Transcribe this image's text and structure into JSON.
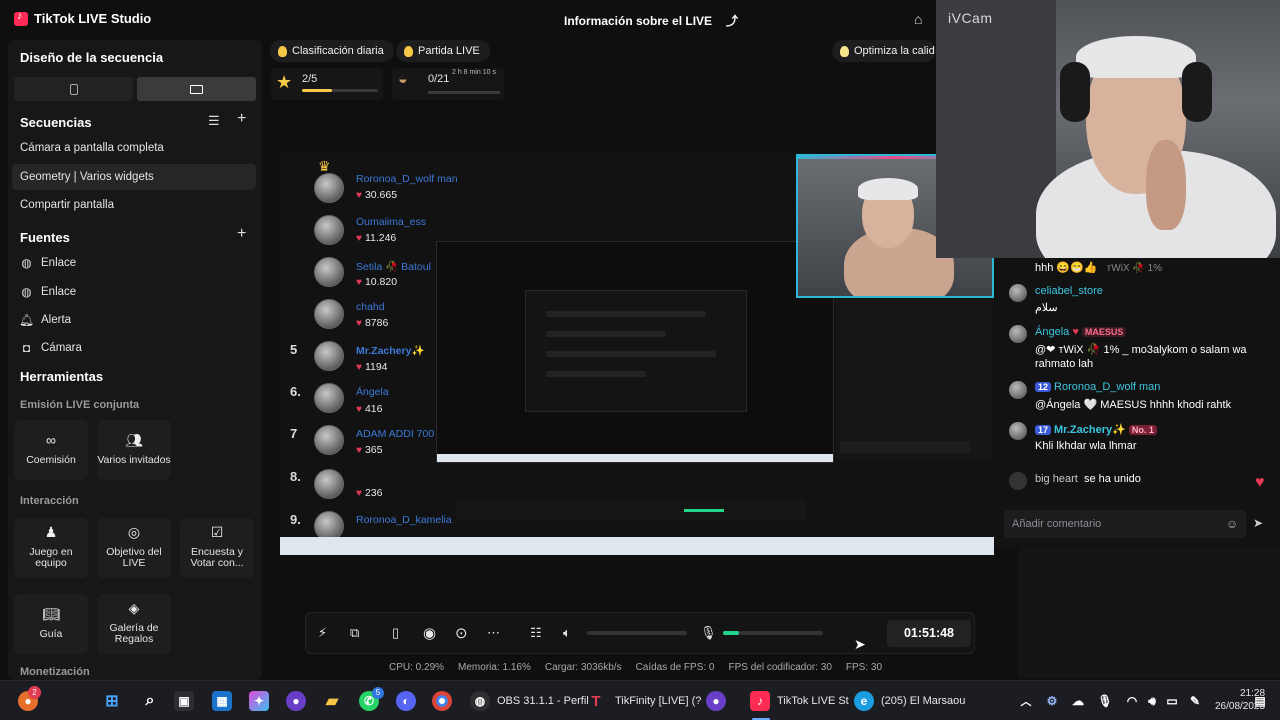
{
  "app": {
    "title": "TikTok LIVE Studio",
    "live_info": "Información sobre el LIVE"
  },
  "sidebar": {
    "design_heading": "Diseño de la secuencia",
    "sequences_heading": "Secuencias",
    "sequences": [
      "Cámara a pantalla completa",
      "Geometry | Varios widgets",
      "Compartir pantalla"
    ],
    "sources_heading": "Fuentes",
    "sources": [
      {
        "label": "Enlace",
        "icon": "globe-icon"
      },
      {
        "label": "Enlace",
        "icon": "globe-icon"
      },
      {
        "label": "Alerta",
        "icon": "bell-icon"
      },
      {
        "label": "Cámara",
        "icon": "camera-icon"
      }
    ],
    "tools_heading": "Herramientas",
    "joint_live": "Emisión LIVE conjunta",
    "tools_joint": [
      "Coemisión",
      "Varios invitados"
    ],
    "interaction": "Interacción",
    "tools_interaction": [
      "Juego en equipo",
      "Objetivo del LIVE",
      "Encuesta y Votar con..."
    ],
    "tools_more": [
      "Guía",
      "Galería de Regalos"
    ],
    "monetization": "Monetización"
  },
  "topbar": {
    "chip_daily": "Clasificación diaria",
    "chip_match": "Partida LIVE",
    "chip_optimize": "Optimiza la calid",
    "stars": "2/5",
    "stars_progress": 0.4,
    "gifts": "0/21",
    "gifts_time": "2 h 8 min 10 s",
    "gifts_progress": 0.0
  },
  "preview": {
    "leaderboard": [
      {
        "rank": "",
        "name": "Roronoa_D_wolf man",
        "score": "30.665"
      },
      {
        "rank": "",
        "name": "Oumaiima_ess",
        "score": "11.246"
      },
      {
        "rank": "",
        "name": "Setila 🥀 Batoul",
        "score": "10.820"
      },
      {
        "rank": "",
        "name": "chahd",
        "score": "8786"
      },
      {
        "rank": "5",
        "name": "Mr.Zachery✨",
        "score": "1194"
      },
      {
        "rank": "6.",
        "name": "Ángela",
        "score": "416"
      },
      {
        "rank": "7",
        "name": "ADAM ADDI 700",
        "score": "365"
      },
      {
        "rank": "8.",
        "name": "",
        "score": "236"
      },
      {
        "rank": "9.",
        "name": "Roronoa_D_kamelia",
        "score": ""
      }
    ]
  },
  "chat": {
    "messages": [
      {
        "name": "",
        "text": "hhh 😄😁👍",
        "extra": "ᴛWiX 🥀 1%"
      },
      {
        "name": "celiabel_store",
        "text": "سلام",
        "badge": ""
      },
      {
        "name": "Ángela",
        "text": "@❤ ᴛWiX 🥀 1% _ mo3alykom o salam wa rahmato lah",
        "badge": "MAESUS"
      },
      {
        "name": "Roronoa_D_wolf man",
        "text": "@Ángela 🤍 MAESUS hhhh khodi rahtk",
        "badge": "12"
      },
      {
        "name": "Mr.Zachery✨",
        "text": "Khli lkhdar wla lhmar",
        "badge": "17",
        "extra": "No. 1"
      },
      {
        "name": "big heart",
        "text": "se ha unido"
      }
    ],
    "input_placeholder": "Añadir comentario"
  },
  "controls": {
    "timer": "01:51:48",
    "mic_level": 0.16,
    "volume_level": 0.0
  },
  "metrics": {
    "cpu": "CPU: 0.29%",
    "memory": "Memoria: 1.16%",
    "load": "Cargar: 3036kb/s",
    "fps_drops": "Caídas de FPS: 0",
    "encoder_fps": "FPS del codificador: 30",
    "fps": "FPS: 30"
  },
  "webcam": {
    "label": "iVCam"
  },
  "taskbar": {
    "apps": [
      "OBS 31.1.1 - Perfil",
      "TikFinity [LIVE] (?",
      "TikTok LIVE St",
      "(205) El Marsaou"
    ],
    "notification_count": "2",
    "whatsapp_count": "5",
    "time": "21:28",
    "date": "26/08/2025"
  }
}
